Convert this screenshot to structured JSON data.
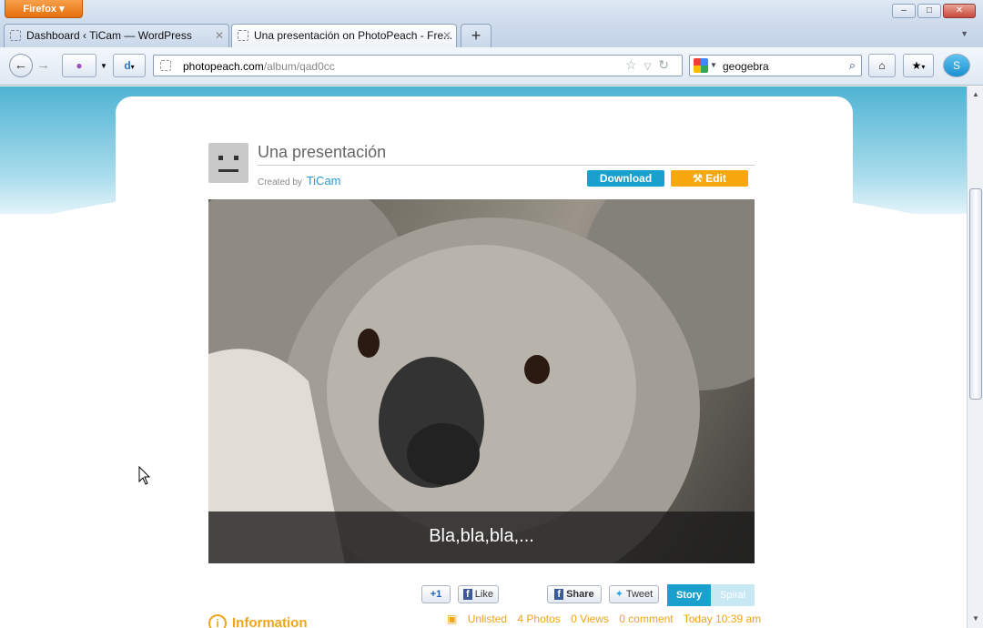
{
  "browser": {
    "app_button": "Firefox",
    "window_controls": [
      "–",
      "□",
      "✕"
    ],
    "tabs": [
      {
        "title": "Dashboard ‹ TiCam — WordPress",
        "active": false
      },
      {
        "title": "Una presentación on PhotoPeach - Fre...",
        "active": true
      }
    ],
    "new_tab": "+",
    "url_host": "photopeach.com",
    "url_path": "/album/qad0cc",
    "search_value": "geogebra"
  },
  "page": {
    "album_title": "Una presentación",
    "created_by_label": "Created by",
    "author": "TiCam",
    "download_label": "Download",
    "edit_label": "Edit",
    "caption": "Bla,bla,bla,...",
    "social": {
      "plus_one": "+1",
      "like": "Like",
      "share": "Share",
      "tweet": "Tweet"
    },
    "view_tabs": {
      "story": "Story",
      "spiral": "Spiral"
    },
    "info_heading": "Information",
    "stats": {
      "visibility": "Unlisted",
      "photos": "4 Photos",
      "views": "0 Views",
      "comments": "0 comment",
      "time": "Today 10:39 am"
    }
  },
  "colors": {
    "accent_blue": "#1aa0cc",
    "accent_orange": "#f6a80e",
    "firefox_orange": "#e76f0c"
  }
}
